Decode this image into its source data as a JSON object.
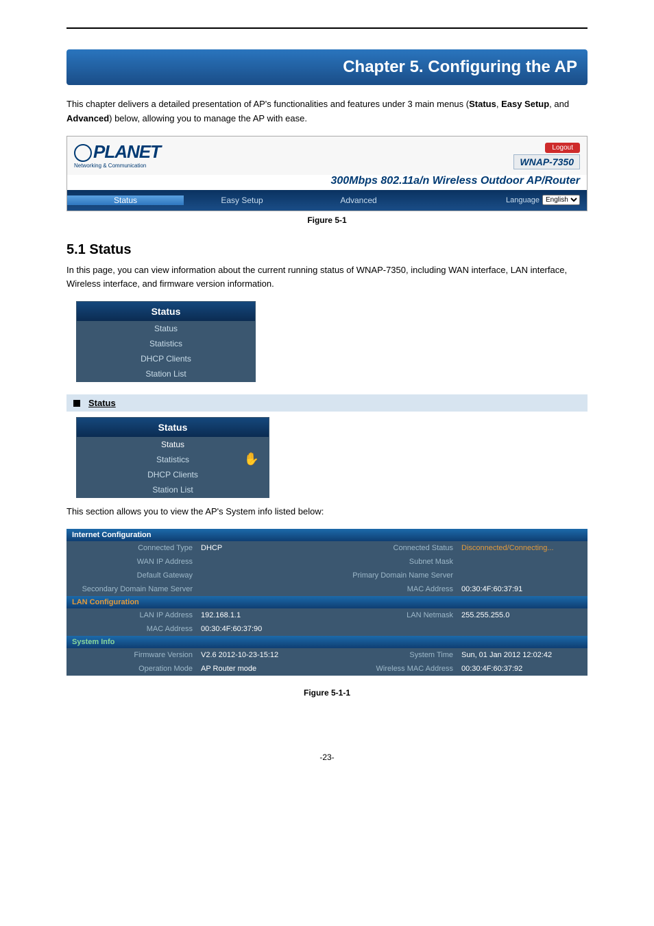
{
  "chapter": {
    "title": "Chapter 5.   Configuring the AP"
  },
  "intro1a": "This chapter delivers a detailed presentation of AP's functionalities and features under 3 main menus (",
  "intro1b": "Status",
  "intro1c": ", ",
  "intro2a": "Easy Setup",
  "intro2b": ", and ",
  "intro2c": "Advanced",
  "intro2d": ") below, allowing you to manage the AP with ease.",
  "nav": {
    "logo_brand": "PLANET",
    "logo_sub": "Networking & Communication",
    "logout": "Logout",
    "model": "WNAP-7350",
    "tagline": "300Mbps 802.11a/n Wireless Outdoor AP/Router",
    "tab_status": "Status",
    "tab_easy": "Easy Setup",
    "tab_adv": "Advanced",
    "lang_label": "Language",
    "lang_value": "English"
  },
  "fig1": "Figure 5-1",
  "sect51": {
    "heading": "5.1  Status",
    "p1": "In this page, you can view information about the current running status of WNAP-7350, including WAN interface, LAN interface, Wireless interface, and firmware version information."
  },
  "panel": {
    "head": "Status",
    "items": [
      "Status",
      "Statistics",
      "DHCP Clients",
      "Station List"
    ]
  },
  "sub_status": "Status",
  "systeminfo_sentence": "This section allows you to view the AP's System info listed below:",
  "cfg": {
    "internet": {
      "title": "Internet Configuration",
      "connected_type_l": "Connected Type",
      "connected_type_v": "DHCP",
      "connected_status_l": "Connected Status",
      "connected_status_v": "Disconnected/Connecting...",
      "wan_ip_l": "WAN IP Address",
      "subnet_l": "Subnet Mask",
      "def_gw_l": "Default Gateway",
      "pdns_l": "Primary Domain Name Server",
      "sdns_l": "Secondary Domain Name Server",
      "mac_l": "MAC Address",
      "mac_v": "00:30:4F:60:37:91"
    },
    "lan": {
      "title": "LAN Configuration",
      "lan_ip_l": "LAN IP Address",
      "lan_ip_v": "192.168.1.1",
      "netmask_l": "LAN Netmask",
      "netmask_v": "255.255.255.0",
      "mac_l": "MAC Address",
      "mac_v": "00:30:4F:60:37:90"
    },
    "sys": {
      "title": "System Info",
      "fw_l": "Firmware Version",
      "fw_v": "V2.6 2012-10-23-15:12",
      "time_l": "System Time",
      "time_v": "Sun, 01 Jan 2012 12:02:42",
      "mode_l": "Operation Mode",
      "mode_v": "AP Router mode",
      "wmac_l": "Wireless MAC Address",
      "wmac_v": "00:30:4F:60:37:92"
    }
  },
  "fig2": "Figure 5-1-1",
  "pagenum": "-23-"
}
